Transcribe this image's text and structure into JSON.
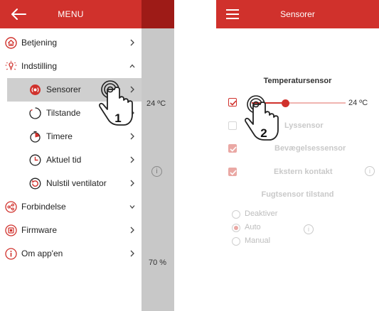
{
  "left_screen": {
    "header": {
      "title": "MENU",
      "back_icon": "back-arrow-icon"
    },
    "menu_items": [
      {
        "label": "Betjening",
        "icon": "home-icon",
        "chevron": "chevron-right"
      },
      {
        "label": "Indstilling",
        "icon": "settings-bulb-icon",
        "chevron": "chevron-up"
      },
      {
        "label": "Sensorer",
        "icon": "sensor-icon",
        "chevron": "chevron-right",
        "selected": true
      },
      {
        "label": "Tilstande",
        "icon": "circle-mode-icon",
        "chevron": "chevron-right"
      },
      {
        "label": "Timere",
        "icon": "timer-icon",
        "chevron": "chevron-right"
      },
      {
        "label": "Aktuel tid",
        "icon": "clock-icon",
        "chevron": "chevron-right"
      },
      {
        "label": "Nulstil ventilator",
        "icon": "reset-fan-icon",
        "chevron": "chevron-right"
      },
      {
        "label": "Forbindelse",
        "icon": "share-connection-icon",
        "chevron": "chevron-down"
      },
      {
        "label": "Firmware",
        "icon": "firmware-chip-icon",
        "chevron": "chevron-right"
      },
      {
        "label": "Om app'en",
        "icon": "info-icon",
        "chevron": "chevron-right"
      }
    ],
    "background_screen": {
      "temperature": "24 ºC",
      "humidity": "70 %",
      "info_symbol": "i"
    },
    "step_badge": "1"
  },
  "right_screen": {
    "header": {
      "title": "Sensorer",
      "menu_icon": "hamburger-icon"
    },
    "temperature_section": {
      "title": "Temperatursensor",
      "enabled": true,
      "slider_value_fraction": 0.36,
      "value_label": "24 ºC"
    },
    "sensors": [
      {
        "label": "Lyssensor",
        "checked": false
      },
      {
        "label": "Bevægelsessensor",
        "checked": true
      },
      {
        "label": "Ekstern kontakt",
        "checked": true
      }
    ],
    "humidity_section": {
      "title": "Fugtsensor tilstand",
      "options": [
        {
          "label": "Deaktiver",
          "selected": false
        },
        {
          "label": "Auto",
          "selected": true
        },
        {
          "label": "Manual",
          "selected": false
        }
      ]
    },
    "info_symbol": "i",
    "step_badge": "2"
  },
  "colors": {
    "header_red": "#d0312c",
    "dark_red": "#9e1b17",
    "selected_gray": "#cfcfcf",
    "disabled_pink": "#eaa8a4"
  }
}
